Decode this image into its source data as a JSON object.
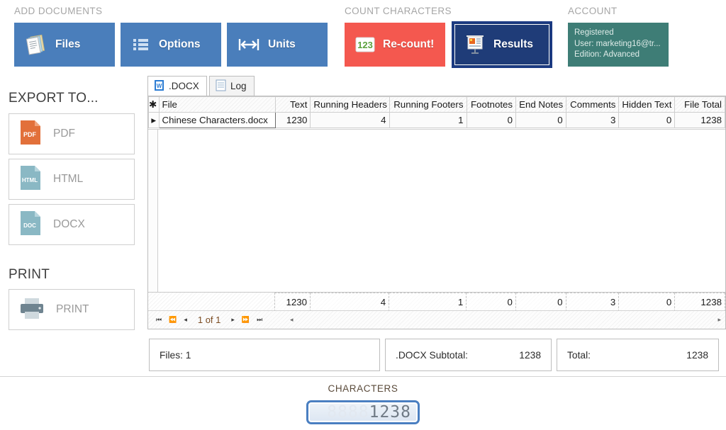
{
  "ribbon": {
    "groups": [
      {
        "id": "add-documents",
        "label": "ADD DOCUMENTS"
      },
      {
        "id": "count-characters",
        "label": "COUNT CHARACTERS"
      },
      {
        "id": "account",
        "label": "ACCOUNT"
      }
    ],
    "buttons": {
      "files": {
        "label": "Files",
        "icon": "documents-icon",
        "color": "#4a7ebb"
      },
      "options": {
        "label": "Options",
        "icon": "list-icon",
        "color": "#4a7ebb"
      },
      "units": {
        "label": "Units",
        "icon": "measure-icon",
        "color": "#4a7ebb"
      },
      "recount": {
        "label": "Re-count!",
        "icon": "123-icon",
        "color": "#f4584f"
      },
      "results": {
        "label": "Results",
        "icon": "presentation-icon",
        "color": "#1f3c78",
        "selected": true
      }
    },
    "account": {
      "status": "Registered",
      "user": "User: marketing16@tr...",
      "edition": "Edition: Advanced",
      "color": "#3e7d76"
    }
  },
  "sidebar": {
    "export_title": "EXPORT TO...",
    "export_items": [
      {
        "label": "PDF",
        "icon": "pdf-file-icon",
        "color": "#e2703a"
      },
      {
        "label": "HTML",
        "icon": "html-file-icon",
        "color": "#8ab8c4"
      },
      {
        "label": "DOCX",
        "icon": "doc-file-icon",
        "color": "#8ab8c4"
      }
    ],
    "print_title": "PRINT",
    "print_items": [
      {
        "label": "PRINT",
        "icon": "printer-icon",
        "color": "#6f8490"
      }
    ]
  },
  "results": {
    "tabs": [
      {
        "label": ".DOCX",
        "icon": "word-doc-icon",
        "active": true
      },
      {
        "label": "Log",
        "icon": "log-doc-icon",
        "active": false
      }
    ],
    "columns": [
      "File",
      "Text",
      "Running Headers",
      "Running Footers",
      "Footnotes",
      "End Notes",
      "Comments",
      "Hidden Text",
      "File Total"
    ],
    "rows": [
      {
        "selected": true,
        "marker": "▸",
        "cells": [
          "Chinese Characters.docx",
          "1230",
          "4",
          "1",
          "0",
          "0",
          "3",
          "0",
          "1238"
        ]
      }
    ],
    "header_marker": "✱",
    "totals": [
      "",
      "1230",
      "4",
      "1",
      "0",
      "0",
      "3",
      "0",
      "1238"
    ],
    "nav": {
      "first": "⏮",
      "prev_page": "⏪",
      "prev": "◂",
      "position": "1 of 1",
      "next": "▸",
      "next_page": "⏩",
      "last": "⏭",
      "scroll_left": "◂",
      "scroll_right": "▸"
    }
  },
  "summary": [
    {
      "label": "Files: 1",
      "value": ""
    },
    {
      "label": ".DOCX Subtotal:",
      "value": "1238"
    },
    {
      "label": "Total:",
      "value": "1238"
    }
  ],
  "counter": {
    "title": "CHARACTERS",
    "value": "1238",
    "digit_slots": 8,
    "off_glyph": "8",
    "frame_color": "#4a7fc1"
  }
}
